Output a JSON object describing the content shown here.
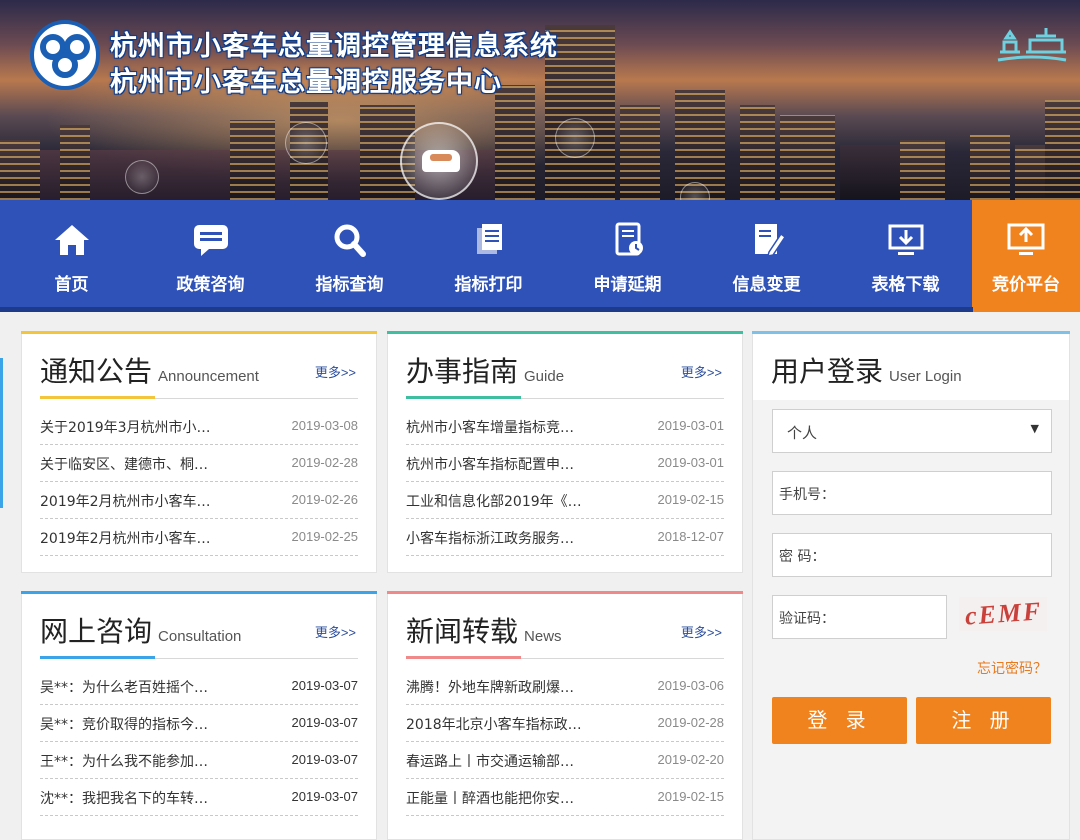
{
  "header": {
    "title_line1": "杭州市小客车总量调控管理信息系统",
    "title_line2": "杭州市小客车总量调控服务中心",
    "logo_icon": "hangzhou-emblem-icon",
    "brand_color": "#1a5fb4"
  },
  "nav": {
    "items": [
      {
        "label": "首页",
        "icon": "home-icon"
      },
      {
        "label": "政策咨询",
        "icon": "chat-icon"
      },
      {
        "label": "指标查询",
        "icon": "search-icon"
      },
      {
        "label": "指标打印",
        "icon": "document-stack-icon"
      },
      {
        "label": "申请延期",
        "icon": "document-clock-icon"
      },
      {
        "label": "信息变更",
        "icon": "edit-icon"
      },
      {
        "label": "表格下载",
        "icon": "download-icon"
      },
      {
        "label": "竞价平台",
        "icon": "monitor-icon"
      }
    ],
    "active_index": 7,
    "nav_color": "#2f52b8",
    "active_color": "#f0831e"
  },
  "announcement": {
    "title_cn": "通知公告",
    "title_en": "Announcement",
    "more": "更多>>",
    "accent": "#f2c53d",
    "items": [
      {
        "text": "关于2019年3月杭州市小…",
        "date": "2019-03-08"
      },
      {
        "text": "关于临安区、建德市、桐…",
        "date": "2019-02-28"
      },
      {
        "text": "2019年2月杭州市小客车…",
        "date": "2019-02-26"
      },
      {
        "text": "2019年2月杭州市小客车…",
        "date": "2019-02-25"
      }
    ]
  },
  "guide": {
    "title_cn": "办事指南",
    "title_en": "Guide",
    "more": "更多>>",
    "accent": "#3fbfa0",
    "items": [
      {
        "text": "杭州市小客车增量指标竞…",
        "date": "2019-03-01"
      },
      {
        "text": "杭州市小客车指标配置申…",
        "date": "2019-03-01"
      },
      {
        "text": "工业和信息化部2019年《…",
        "date": "2019-02-15"
      },
      {
        "text": "小客车指标浙江政务服务…",
        "date": "2018-12-07"
      }
    ]
  },
  "consultation": {
    "title_cn": "网上咨询",
    "title_en": "Consultation",
    "more": "更多>>",
    "accent": "#3ba3e8",
    "items": [
      {
        "text": "吴**：为什么老百姓摇个…",
        "date": "2019-03-07"
      },
      {
        "text": "吴**：竞价取得的指标今…",
        "date": "2019-03-07"
      },
      {
        "text": "王**：为什么我不能参加…",
        "date": "2019-03-07"
      },
      {
        "text": "沈**：我把我名下的车转…",
        "date": "2019-03-07"
      }
    ]
  },
  "news": {
    "title_cn": "新闻转载",
    "title_en": "News",
    "more": "更多>>",
    "accent": "#f08a8a",
    "items": [
      {
        "text": "沸腾！外地车牌新政刷爆…",
        "date": "2019-03-06"
      },
      {
        "text": "2018年北京小客车指标政…",
        "date": "2019-02-28"
      },
      {
        "text": "春运路上丨市交通运输部…",
        "date": "2019-02-20"
      },
      {
        "text": "正能量丨醉酒也能把你安…",
        "date": "2019-02-15"
      }
    ]
  },
  "login": {
    "title_cn": "用户登录",
    "title_en": "User Login",
    "account_type": "个人",
    "phone_label": "手机号：",
    "password_label": "密 码：",
    "captcha_label": "验证码：",
    "captcha_text": "cEMF",
    "forgot": "忘记密码？",
    "login_btn": "登 录",
    "register_btn": "注 册",
    "button_color": "#f0831e"
  }
}
